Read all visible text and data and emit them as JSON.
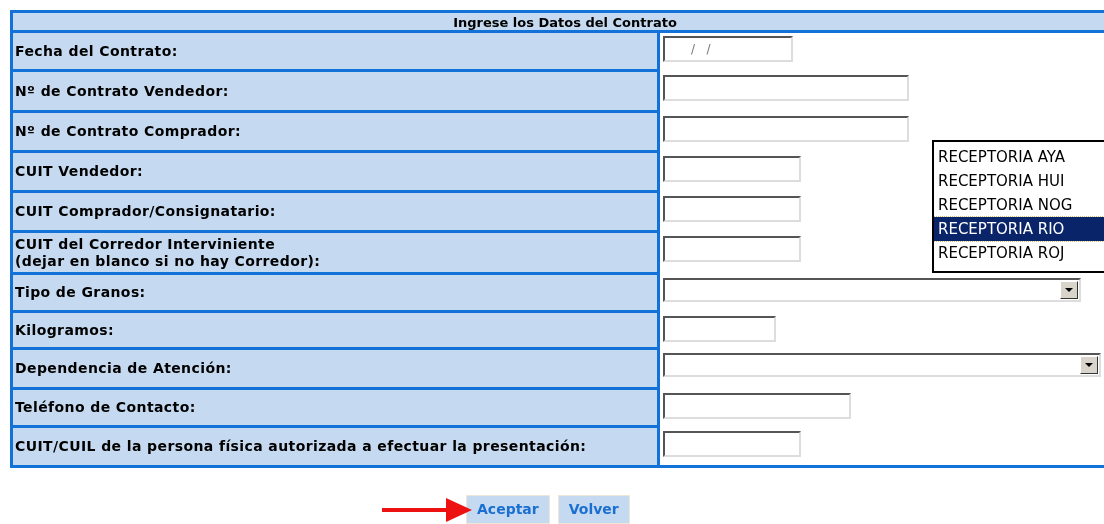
{
  "form": {
    "title": "Ingrese los Datos del Contrato",
    "rows": [
      {
        "label": "Fecha del Contrato:",
        "kind": "date",
        "value": "/   /"
      },
      {
        "label": "Nº de Contrato Vendedor:",
        "kind": "text"
      },
      {
        "label": "Nº de Contrato Comprador:",
        "kind": "text"
      },
      {
        "label": "CUIT Vendedor:",
        "kind": "text"
      },
      {
        "label": "CUIT Comprador/Consignatario:",
        "kind": "text"
      },
      {
        "label": "CUIT del Corredor Interviniente\n(dejar en blanco si no hay Corredor):",
        "kind": "text"
      },
      {
        "label": "Tipo de Granos:",
        "kind": "select"
      },
      {
        "label": "Kilogramos:",
        "kind": "text"
      },
      {
        "label": "Dependencia de Atención:",
        "kind": "select"
      },
      {
        "label": "Teléfono de Contacto:",
        "kind": "text"
      },
      {
        "label": "CUIT/CUIL de la persona física autorizada a efectuar la presentación:",
        "kind": "text"
      }
    ]
  },
  "dropdown_list": {
    "items": [
      {
        "label": "RECEPTORIA AYA",
        "selected": false
      },
      {
        "label": "RECEPTORIA HUI",
        "selected": false
      },
      {
        "label": "RECEPTORIA NOG",
        "selected": false
      },
      {
        "label": "RECEPTORIA RIO",
        "selected": true
      },
      {
        "label": "RECEPTORIA ROJ",
        "selected": false
      }
    ]
  },
  "buttons": [
    {
      "label": "Aceptar"
    },
    {
      "label": "Volver"
    }
  ]
}
